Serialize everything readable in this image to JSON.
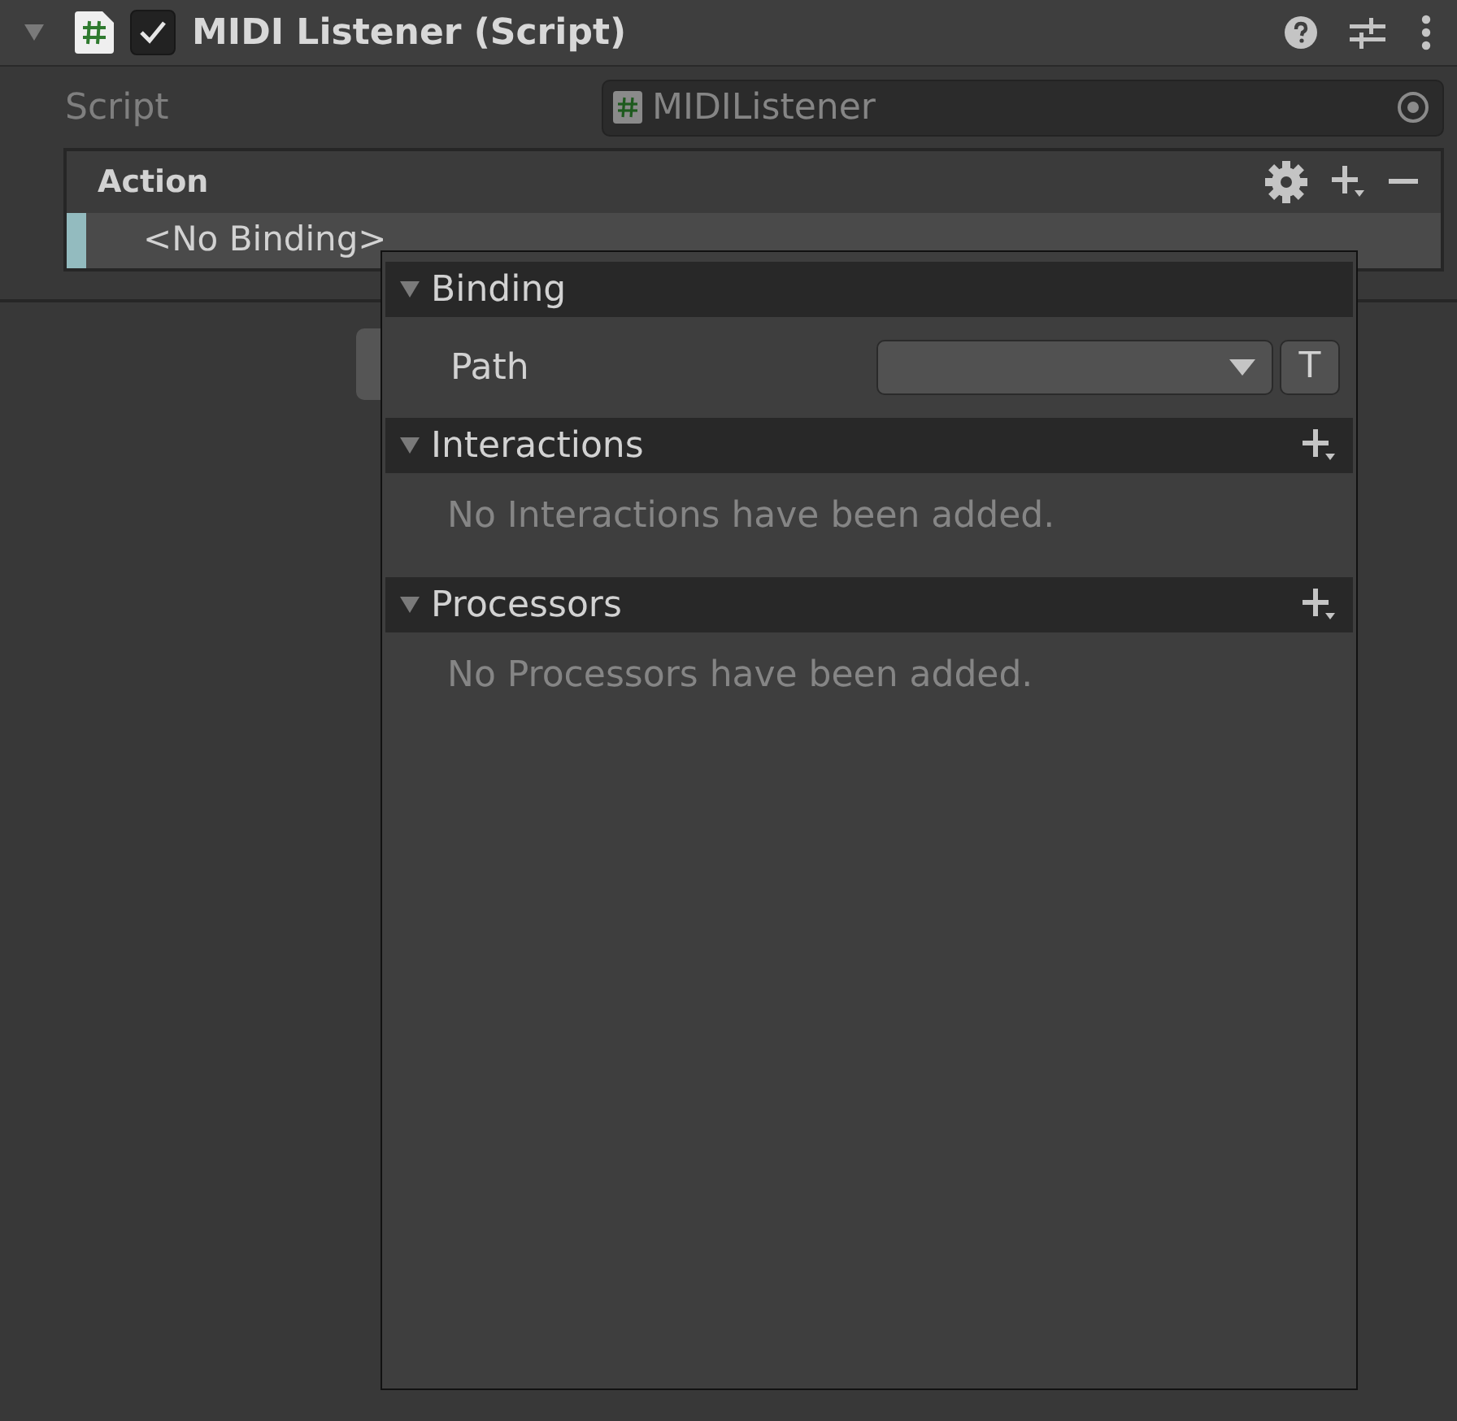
{
  "component": {
    "title": "MIDI Listener (Script)",
    "enabled": true,
    "expanded": true
  },
  "script": {
    "label": "Script",
    "value": "MIDIListener"
  },
  "action_list": {
    "header": "Action",
    "items": [
      {
        "label": "<No Binding>",
        "selected": true
      }
    ]
  },
  "popup": {
    "sections": [
      {
        "kind": "fields",
        "title": "Binding",
        "expanded": true,
        "fields": [
          {
            "label": "Path",
            "toggle": "T"
          }
        ]
      },
      {
        "kind": "list",
        "title": "Interactions",
        "expanded": true,
        "empty_text": "No Interactions have been added."
      },
      {
        "kind": "list",
        "title": "Processors",
        "expanded": true,
        "empty_text": "No Processors have been added."
      }
    ]
  }
}
